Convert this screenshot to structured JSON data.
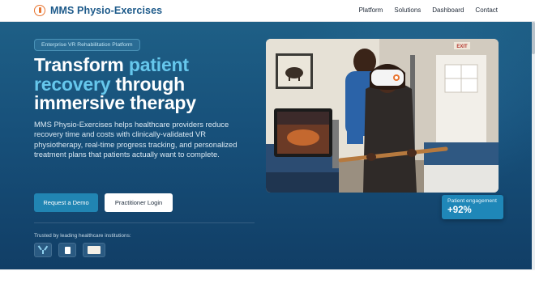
{
  "brand": {
    "name": "MMS Physio-Exercises"
  },
  "nav": {
    "links": [
      "Platform",
      "Solutions",
      "Dashboard",
      "Contact"
    ]
  },
  "hero": {
    "pill": "Enterprise VR Rehabilitation Platform",
    "headline_part1": "Transform ",
    "headline_accent": "patient recovery",
    "headline_part2": " through immersive therapy",
    "description": "MMS Physio-Exercises helps healthcare providers reduce recovery time and costs with clinically-validated VR physiotherapy, real-time progress tracking, and personalized treatment plans that patients actually want to complete.",
    "primary_button": "Request a Demo",
    "secondary_button": "Practitioner Login",
    "trusted_label": "Trusted by leading healthcare institutions:",
    "partner_logos": [
      "partner-logo-1",
      "partner-logo-2",
      "partner-logo-3"
    ]
  },
  "stat": {
    "label": "Patient engagement",
    "value": "+92%"
  },
  "colors": {
    "accent": "#66c7ec",
    "primary": "#2185b3",
    "brand": "#1d5a8a",
    "logo_orange": "#e8742f"
  }
}
